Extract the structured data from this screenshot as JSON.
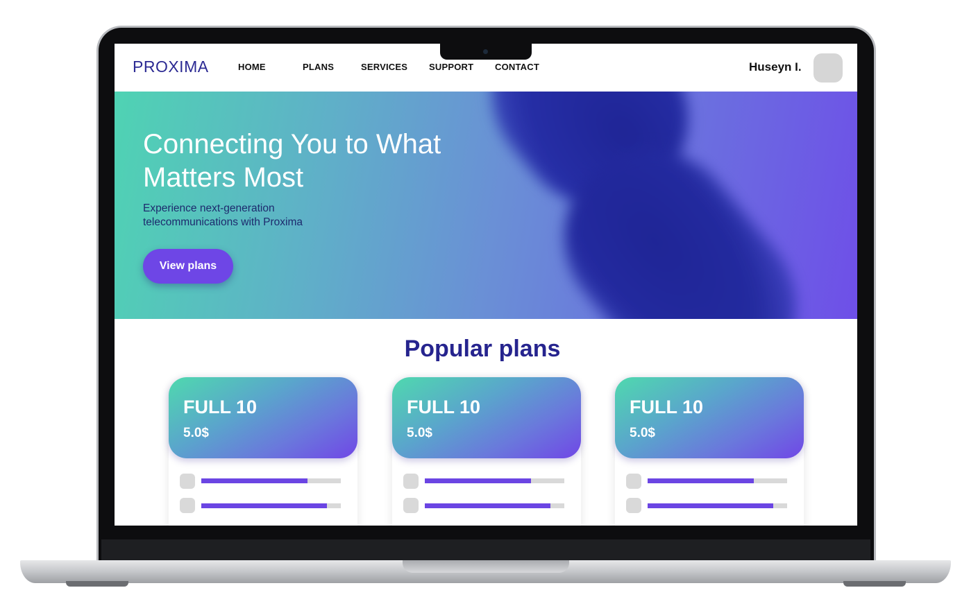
{
  "nav": {
    "logo": "PROXIMA",
    "links": [
      "HOME",
      "PLANS",
      "SERVICES",
      "SUPPORT",
      "CONTACT"
    ],
    "user_name": "Huseyn I."
  },
  "hero": {
    "title": "Connecting You to What Matters Most",
    "subtitle": "Experience next-generation telecommunications with Proxima",
    "button_label": "View plans"
  },
  "plans": {
    "section_title": "Popular plans",
    "cards": [
      {
        "name": "FULL 10",
        "price": "5.0$",
        "features": [
          0.76,
          0.9
        ]
      },
      {
        "name": "FULL 10",
        "price": "5.0$",
        "features": [
          0.76,
          0.9
        ]
      },
      {
        "name": "FULL 10",
        "price": "5.0$",
        "features": [
          0.76,
          0.9
        ]
      }
    ]
  },
  "colors": {
    "brand": "#2c2a93",
    "accent": "#6e46e6",
    "title": "#26248e"
  }
}
